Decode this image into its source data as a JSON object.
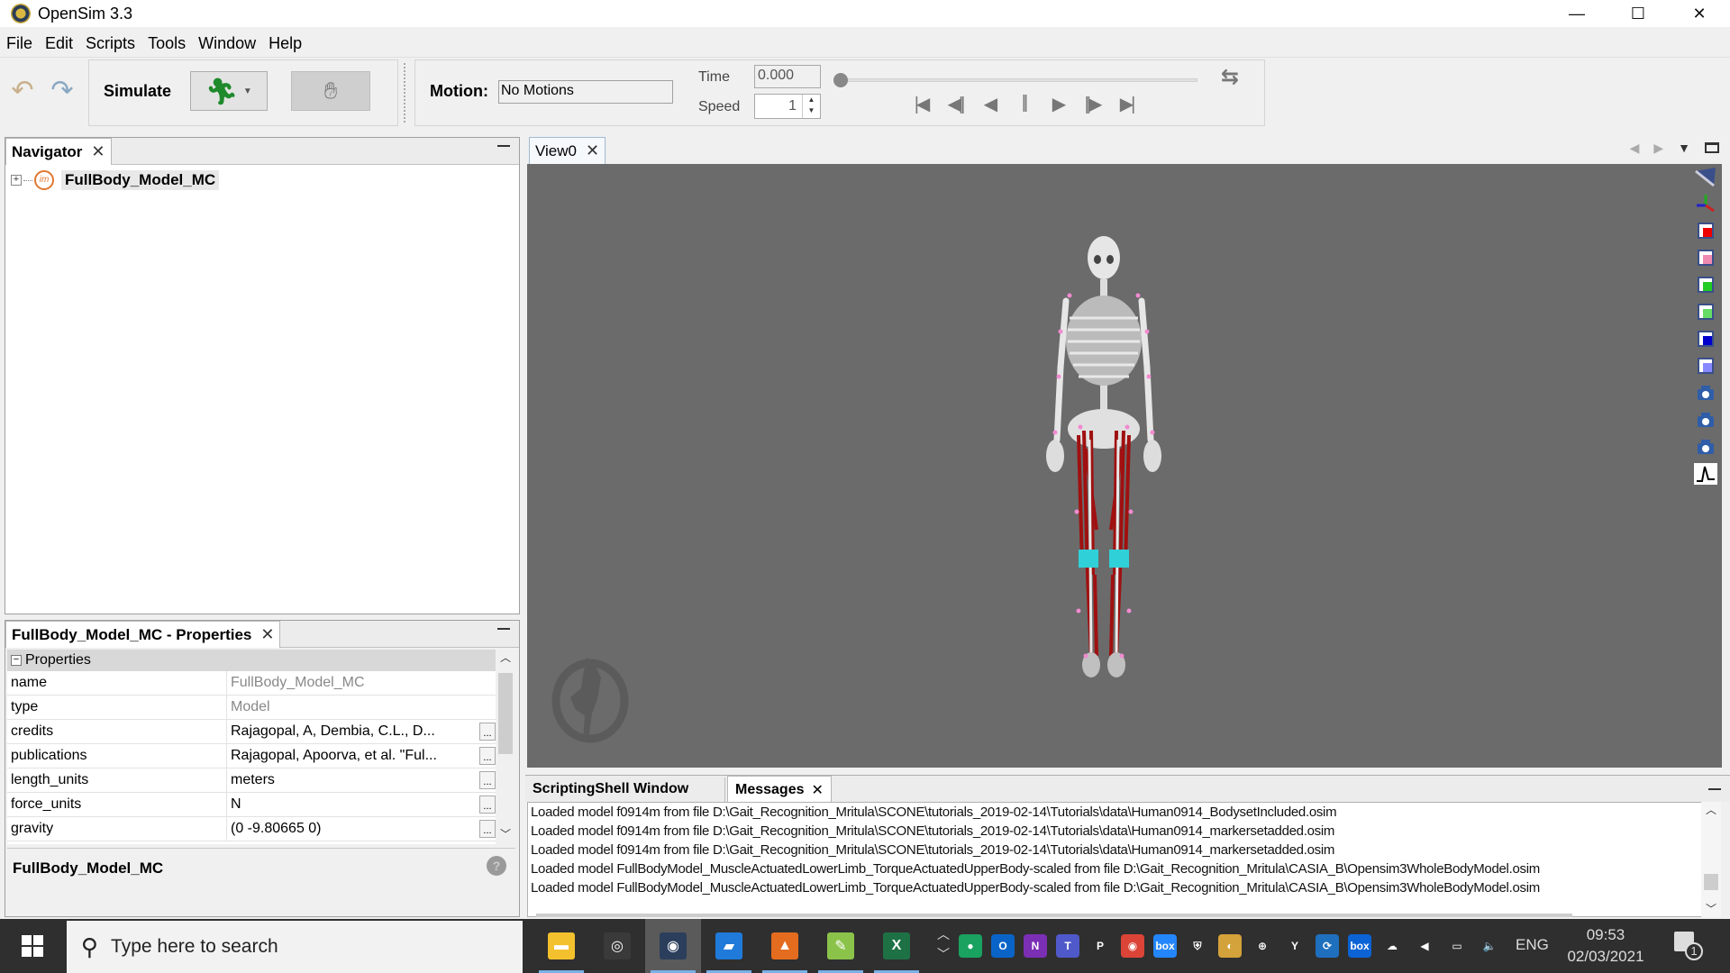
{
  "window": {
    "title": "OpenSim 3.3",
    "controls": {
      "minimize": "—",
      "maximize": "☐",
      "close": "✕"
    }
  },
  "menu": [
    "File",
    "Edit",
    "Scripts",
    "Tools",
    "Window",
    "Help"
  ],
  "toolbar": {
    "undo_icon": "undo-icon",
    "redo_icon": "redo-icon",
    "simulate_label": "Simulate",
    "run_icon": "running-man-icon",
    "hand_icon": "hand-icon",
    "motion_label": "Motion:",
    "motion_value": "No Motions",
    "time_label": "Time",
    "time_value": "0.000",
    "speed_label": "Speed",
    "speed_value": "1",
    "time_slider_fraction": 0,
    "transport": [
      "first-frame",
      "step-back",
      "play-reverse",
      "pause",
      "play",
      "step-forward",
      "last-frame"
    ]
  },
  "navigator": {
    "tab_label": "Navigator",
    "tree": [
      {
        "label": "FullBody_Model_MC",
        "expanded": false
      }
    ]
  },
  "properties": {
    "tab_label": "FullBody_Model_MC - Properties",
    "section_label": "Properties",
    "rows": [
      {
        "name": "name",
        "value": "FullBody_Model_MC",
        "readonly": true,
        "editor": false
      },
      {
        "name": "type",
        "value": "Model",
        "readonly": true,
        "editor": false
      },
      {
        "name": "credits",
        "value": "Rajagopal, A, Dembia, C.L., D...",
        "readonly": false,
        "editor": true
      },
      {
        "name": "publications",
        "value": "Rajagopal, Apoorva, et al. \"Ful...",
        "readonly": false,
        "editor": true
      },
      {
        "name": "length_units",
        "value": "meters",
        "readonly": false,
        "editor": true
      },
      {
        "name": "force_units",
        "value": "N",
        "readonly": false,
        "editor": true
      },
      {
        "name": "gravity",
        "value": "(0 -9.80665 0)",
        "readonly": false,
        "editor": true
      }
    ],
    "ellipsis": "...",
    "description_title": "FullBody_Model_MC",
    "help_icon": "?"
  },
  "view": {
    "tab_label": "View0",
    "tools": [
      "annotate-icon",
      "axes-icon",
      "front-view-icon",
      "back-view-icon",
      "top-view-icon",
      "bottom-view-icon",
      "left-view-icon",
      "right-view-icon",
      "snapshot-icon",
      "movie-icon",
      "record-icon",
      "plot-icon"
    ]
  },
  "messages": {
    "tabs": [
      "ScriptingShell Window",
      "Messages"
    ],
    "active_tab": "Messages",
    "lines": [
      "Loaded model f0914m from file D:\\Gait_Recognition_Mritula\\SCONE\\tutorials_2019-02-14\\Tutorials\\data\\Human0914_BodysetIncluded.osim",
      "Loaded model f0914m from file D:\\Gait_Recognition_Mritula\\SCONE\\tutorials_2019-02-14\\Tutorials\\data\\Human0914_markersetadded.osim",
      "Loaded model f0914m from file D:\\Gait_Recognition_Mritula\\SCONE\\tutorials_2019-02-14\\Tutorials\\data\\Human0914_markersetadded.osim",
      "Loaded model FullBodyModel_MuscleActuatedLowerLimb_TorqueActuatedUpperBody-scaled from file D:\\Gait_Recognition_Mritula\\CASIA_B\\Opensim3WholeBodyModel.osim",
      "Loaded model FullBodyModel_MuscleActuatedLowerLimb_TorqueActuatedUpperBody-scaled from file D:\\Gait_Recognition_Mritula\\CASIA_B\\Opensim3WholeBodyModel.osim"
    ]
  },
  "taskbar": {
    "search_placeholder": "Type here to search",
    "apps": [
      {
        "name": "file-explorer",
        "color": "#f3c12e",
        "glyph": "▬",
        "active": false,
        "open": true
      },
      {
        "name": "opensim-old",
        "color": "#3a3a3a",
        "glyph": "◎",
        "active": false,
        "open": false
      },
      {
        "name": "opensim",
        "color": "#2b3e5c",
        "glyph": "◉",
        "active": true,
        "open": true
      },
      {
        "name": "office",
        "color": "#1f7ad9",
        "glyph": "▰",
        "active": false,
        "open": true
      },
      {
        "name": "matlab",
        "color": "#e46c1e",
        "glyph": "▲",
        "active": false,
        "open": true
      },
      {
        "name": "notepad-plus",
        "color": "#8bc34a",
        "glyph": "✎",
        "active": false,
        "open": true
      },
      {
        "name": "excel",
        "color": "#1e7145",
        "glyph": "X",
        "active": false,
        "open": true
      }
    ],
    "tray": [
      {
        "name": "hangouts",
        "color": "#1aa260",
        "glyph": "●"
      },
      {
        "name": "outlook",
        "color": "#0a64c8",
        "glyph": "O"
      },
      {
        "name": "onenote",
        "color": "#7b2fb5",
        "glyph": "N"
      },
      {
        "name": "teams",
        "color": "#5059c9",
        "glyph": "T"
      },
      {
        "name": "pushbullet",
        "color": "#2f2f2f",
        "glyph": "P"
      },
      {
        "name": "chrome",
        "color": "#db4437",
        "glyph": "◉"
      },
      {
        "name": "box",
        "color": "#2486fc",
        "glyph": "box"
      },
      {
        "name": "defender",
        "color": "#2f2f2f",
        "glyph": "⛨"
      },
      {
        "name": "backup",
        "color": "#d4a23a",
        "glyph": "◐"
      },
      {
        "name": "greenshot",
        "color": "#2f2f2f",
        "glyph": "⊕"
      },
      {
        "name": "yammer",
        "color": "#2f2f2f",
        "glyph": "Y"
      },
      {
        "name": "sync",
        "color": "#1f6fbf",
        "glyph": "⟳"
      },
      {
        "name": "box-drive",
        "color": "#0b63d6",
        "glyph": "box"
      },
      {
        "name": "onedrive",
        "color": "#2f2f2f",
        "glyph": "☁"
      },
      {
        "name": "speaker-red",
        "color": "#2f2f2f",
        "glyph": "◀"
      },
      {
        "name": "network",
        "color": "#2f2f2f",
        "glyph": "▭"
      },
      {
        "name": "volume",
        "color": "#2f2f2f",
        "glyph": "🔈"
      }
    ],
    "language": "ENG",
    "time": "09:53",
    "date": "02/03/2021",
    "notifications": "1"
  }
}
